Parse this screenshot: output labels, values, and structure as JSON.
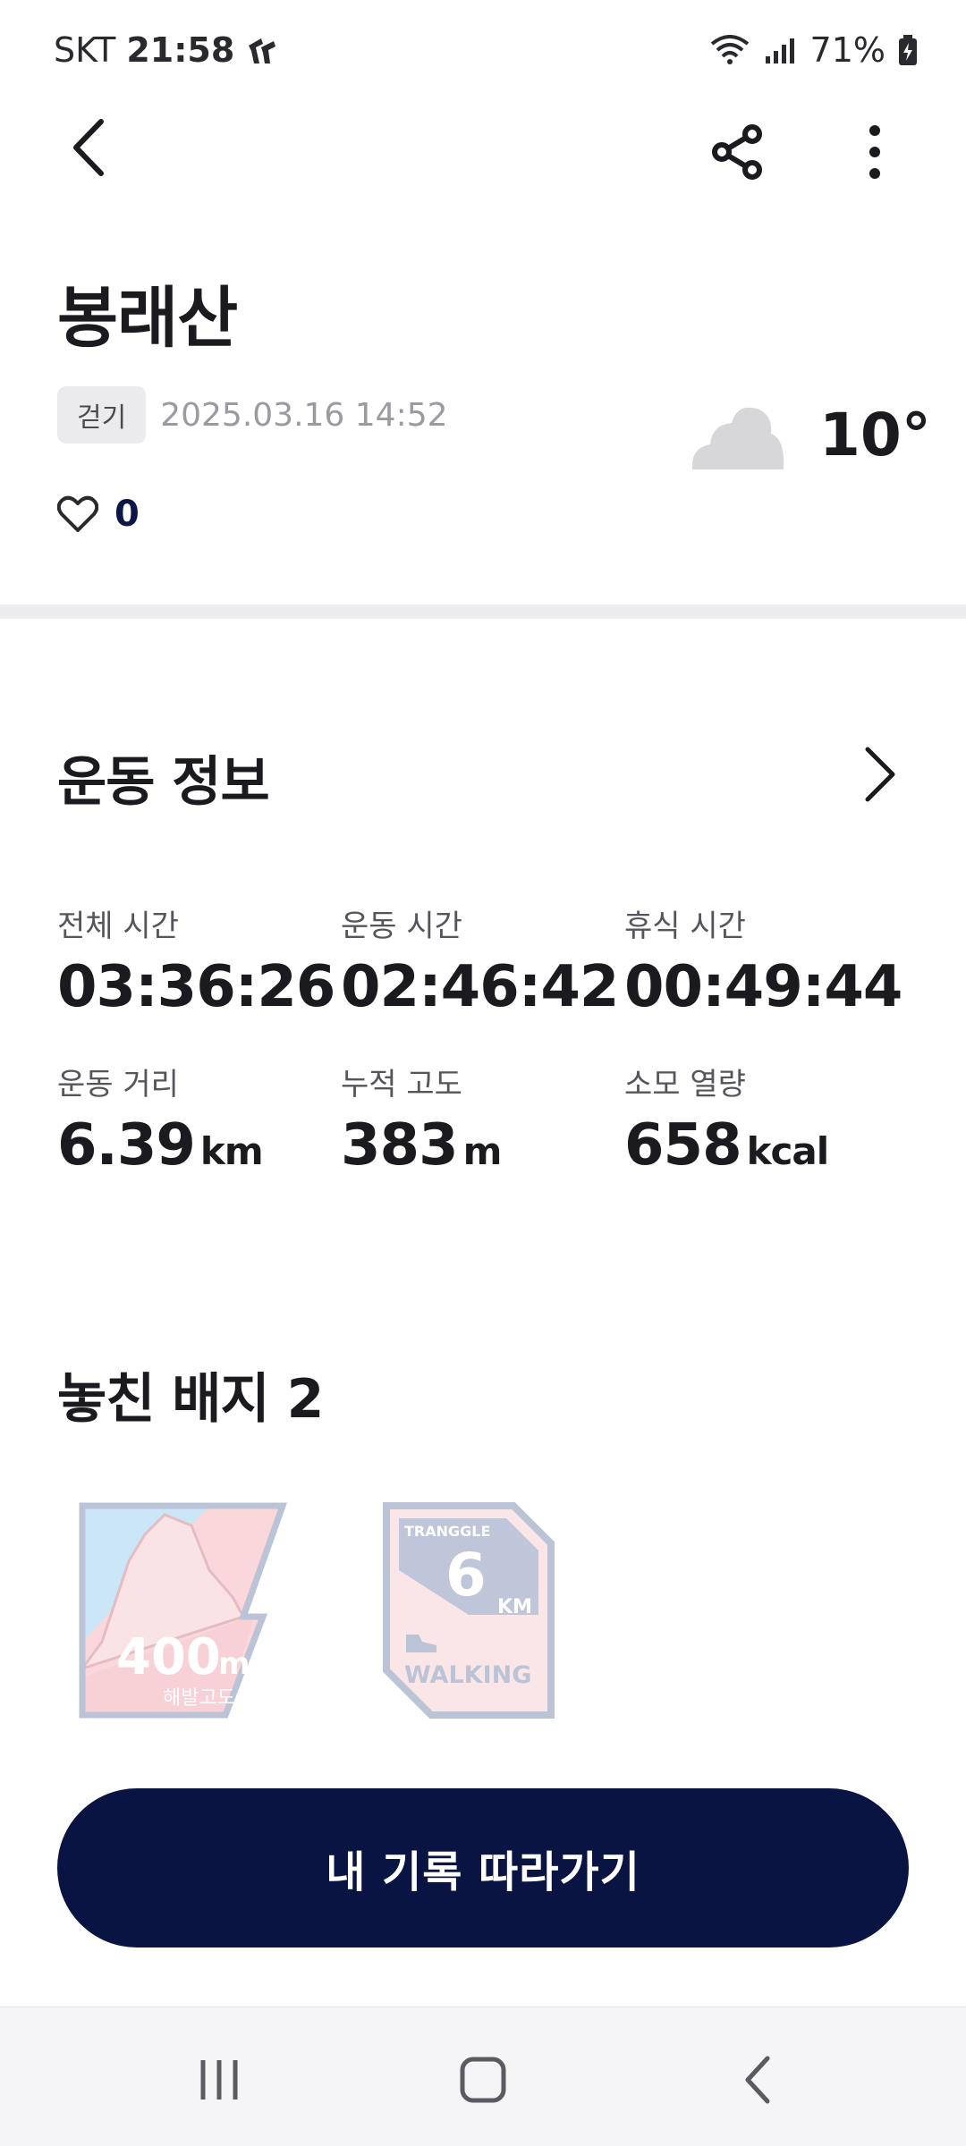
{
  "status_bar": {
    "carrier": "SKT",
    "time": "21:58",
    "battery": "71%"
  },
  "header": {
    "title": "봉래산",
    "activity_chip": "걷기",
    "datetime": "2025.03.16 14:52",
    "likes": "0",
    "temperature": "10°",
    "weather_icon": "cloud-icon"
  },
  "exercise_info": {
    "title": "운동 정보",
    "stats": [
      {
        "label": "전체 시간",
        "value": "03:36:26",
        "unit": ""
      },
      {
        "label": "운동 시간",
        "value": "02:46:42",
        "unit": ""
      },
      {
        "label": "휴식 시간",
        "value": "00:49:44",
        "unit": ""
      },
      {
        "label": "운동 거리",
        "value": "6.39",
        "unit": "km"
      },
      {
        "label": "누적 고도",
        "value": "383",
        "unit": "m"
      },
      {
        "label": "소모 열량",
        "value": "658",
        "unit": "kcal"
      }
    ]
  },
  "missed_badges": {
    "title": "놓친 배지 2",
    "items": [
      {
        "value": "400",
        "unit": "m",
        "caption": "해발고도"
      },
      {
        "brand": "TRANGGLE",
        "value": "6",
        "unit": "KM",
        "caption": "WALKING"
      }
    ]
  },
  "primary_action": {
    "label": "내 기록 따라가기"
  },
  "colors": {
    "primary": "#0a1443",
    "divider": "#ececee",
    "muted_text": "#9a9aa0"
  }
}
